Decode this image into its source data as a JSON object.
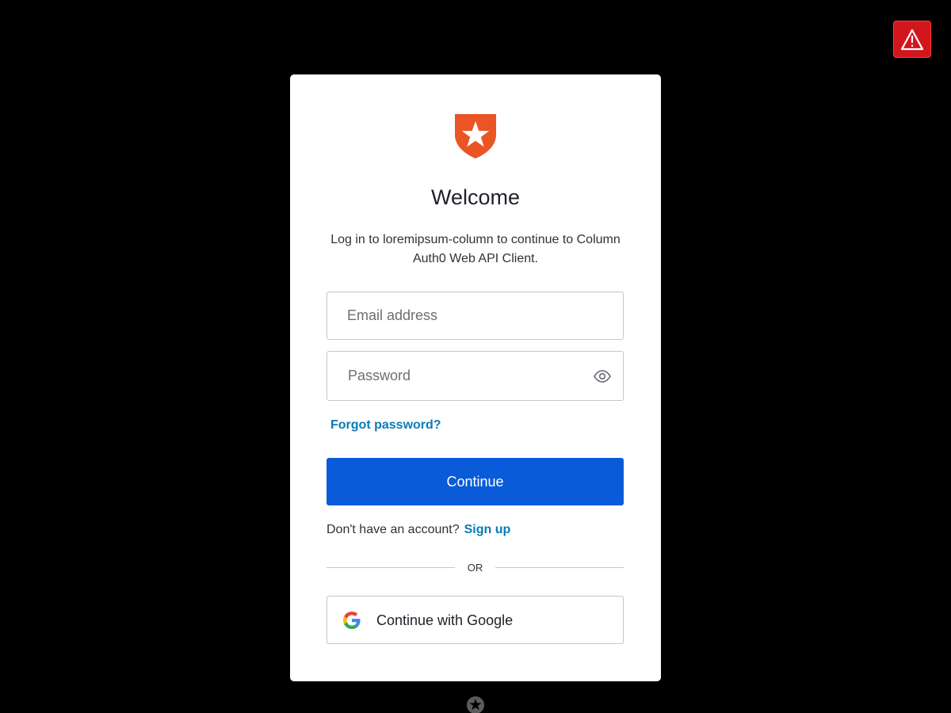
{
  "header": {
    "warning_icon": "warning-triangle-icon"
  },
  "login": {
    "logo_icon": "auth0-shield-star-icon",
    "title": "Welcome",
    "subtitle": "Log in to loremipsum-column to continue to Column Auth0 Web API Client.",
    "email_placeholder": "Email address",
    "email_value": "",
    "password_placeholder": "Password",
    "password_value": "",
    "show_password_icon": "eye-icon",
    "forgot_password": "Forgot password?",
    "continue_label": "Continue",
    "no_account_text": "Don't have an account?",
    "signup_label": "Sign up",
    "divider_text": "OR",
    "google_icon": "google-g-icon",
    "google_label": "Continue with Google"
  },
  "footer": {
    "logo_icon": "auth0-badge-icon"
  },
  "colors": {
    "background": "#000000",
    "card": "#ffffff",
    "primary_button": "#0a5bd9",
    "link": "#0a7ab6",
    "brand_orange": "#eb5424",
    "warning_red": "#d2161d"
  }
}
